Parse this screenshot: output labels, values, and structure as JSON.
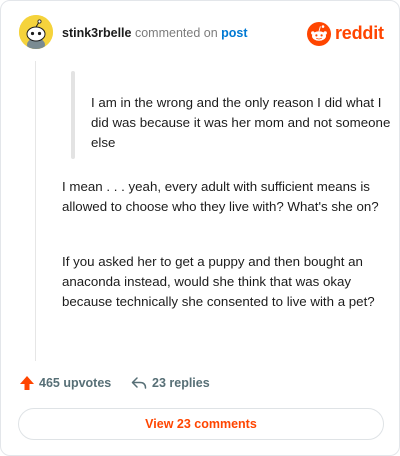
{
  "header": {
    "username": "stink3rbelle",
    "verb": "commented on",
    "post_link": "post",
    "logo_text": "reddit"
  },
  "comment": {
    "quote": "I am in the wrong and the only reason I did what I did was because it was her mom and not someone else",
    "paragraphs": [
      "I mean . . . yeah, every adult with sufficient means is allowed to choose who they live with? What's she on?",
      "If you asked her to get a puppy and then bought an anaconda instead, would she think that was okay because technically she consented to live with a pet?"
    ]
  },
  "footer": {
    "upvotes": "465 upvotes",
    "replies": "23 replies",
    "view_button": "View 23 comments"
  },
  "colors": {
    "accent": "#ff4500",
    "link": "#0079d3",
    "muted": "#576f76"
  },
  "icons": [
    "snoo-avatar-icon",
    "reddit-logo-icon",
    "upvote-arrow-icon",
    "reply-arrow-icon"
  ]
}
